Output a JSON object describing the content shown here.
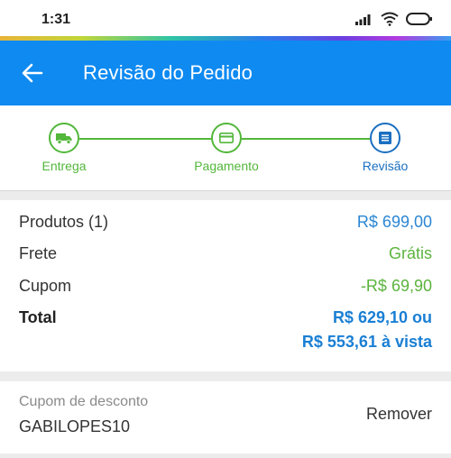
{
  "status_bar": {
    "time": "1:31"
  },
  "header": {
    "title": "Revisão do Pedido"
  },
  "stepper": {
    "steps": [
      {
        "label": "Entrega",
        "icon": "truck-icon"
      },
      {
        "label": "Pagamento",
        "icon": "card-icon"
      },
      {
        "label": "Revisão",
        "icon": "list-icon"
      }
    ]
  },
  "summary": {
    "products_label": "Produtos (1)",
    "products_value": "R$ 699,00",
    "shipping_label": "Frete",
    "shipping_value": "Grátis",
    "coupon_label": "Cupom",
    "coupon_value": "-R$ 69,90",
    "total_label": "Total",
    "total_line1": "R$ 629,10 ou",
    "total_line2": "R$ 553,61 à vista"
  },
  "coupon": {
    "label": "Cupom de desconto",
    "code": "GABILOPES10",
    "remove_label": "Remover"
  },
  "colors": {
    "brand": "#0f8af1",
    "step_done": "#52b73a",
    "step_active": "#1a6fc0",
    "price_blue": "#2a86d4",
    "discount_green": "#5cb33e"
  }
}
